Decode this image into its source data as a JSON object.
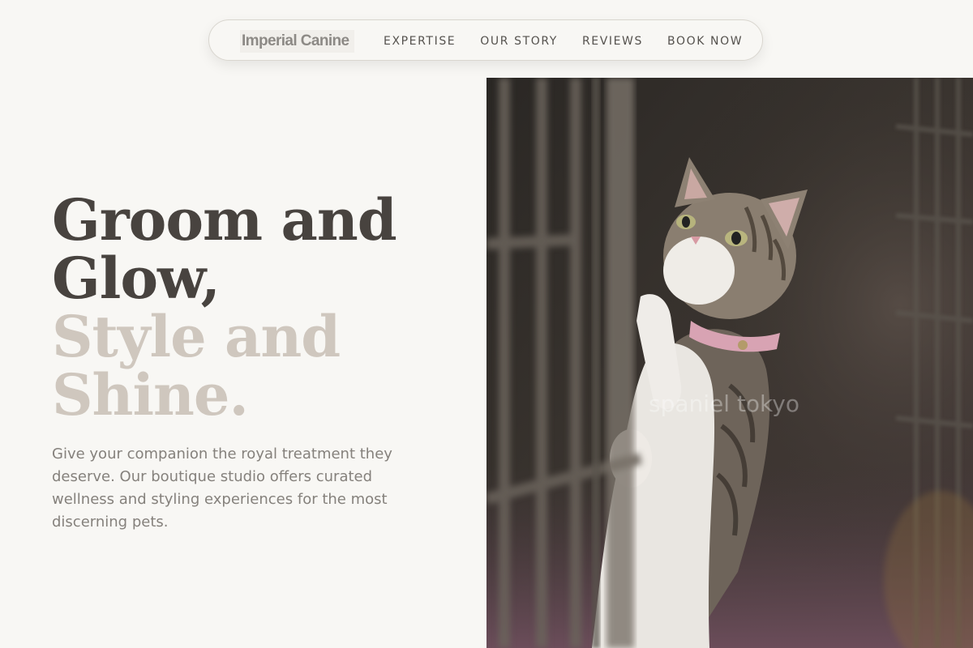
{
  "nav": {
    "brand": "Imperial Canine",
    "links": [
      "EXPERTISE",
      "OUR STORY",
      "REVIEWS",
      "BOOK NOW"
    ]
  },
  "hero": {
    "title_dark": [
      "Groom and",
      "Glow,"
    ],
    "title_light": [
      "Style and",
      "Shine."
    ],
    "description": "Give your companion the royal treatment they deserve. Our boutique studio offers curated wellness and styling experiences for the most discerning pets."
  },
  "photo": {
    "subject": "kitten-in-cage",
    "watermark": "spaniel tokyo"
  },
  "colors": {
    "background": "#f8f7f4",
    "title_dark": "#48433f",
    "title_light": "#cfc7be",
    "body_text": "#85817c",
    "nav_text": "#55524e"
  }
}
